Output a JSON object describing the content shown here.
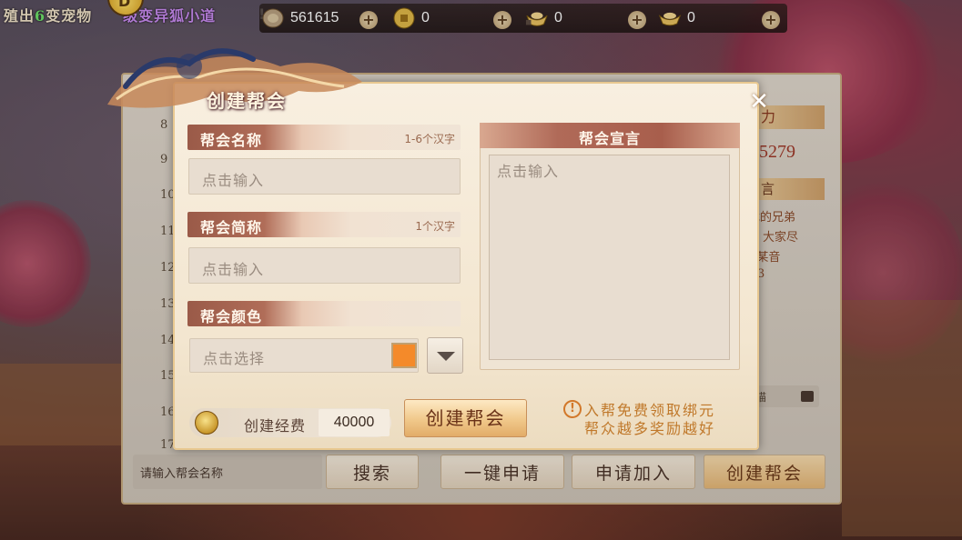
{
  "top_bar": {
    "left_text_a": "殖出",
    "left_text_num": "6",
    "left_text_b": "变宠物",
    "left_text_c": "级变异狐小道",
    "badge": "D",
    "exclaim": "!"
  },
  "currencies": [
    {
      "icon": "silver-coin-icon",
      "value": "561615"
    },
    {
      "icon": "gold-coin-icon",
      "value": "0"
    },
    {
      "icon": "bound-ingot-icon",
      "value": "0"
    },
    {
      "icon": "ingot-icon",
      "value": "0"
    }
  ],
  "plus_label": "+",
  "guild_list": {
    "row_numbers": [
      "8",
      "9",
      "10",
      "11",
      "12",
      "13",
      "14",
      "15",
      "16",
      "17"
    ],
    "right_head": "力",
    "right_value": "5279",
    "right_head2": "言",
    "right_lines": [
      "戏的兄弟",
      "大家尽",
      "!  某音",
      "3"
    ],
    "right_field_text": "喵",
    "search_placeholder": "请输入帮会名称",
    "buttons": {
      "search": "搜索",
      "quick_apply": "一键申请",
      "apply": "申请加入",
      "create": "创建帮会"
    }
  },
  "modal": {
    "title": "创建帮会",
    "close": "✕",
    "name": {
      "label": "帮会名称",
      "hint": "1-6个汉字",
      "placeholder": "点击输入"
    },
    "short_name": {
      "label": "帮会简称",
      "hint": "1个汉字",
      "placeholder": "点击输入"
    },
    "color": {
      "label": "帮会颜色",
      "placeholder": "点击选择",
      "swatch": "#f48a2a"
    },
    "declaration": {
      "label": "帮会宣言",
      "placeholder": "点击输入"
    },
    "cost": {
      "label": "创建经费",
      "value": "40000"
    },
    "create_button": "创建帮会",
    "notice_icon": "!",
    "notice_line1": "入帮免费领取绑元",
    "notice_line2": "帮众越多奖励越好"
  }
}
